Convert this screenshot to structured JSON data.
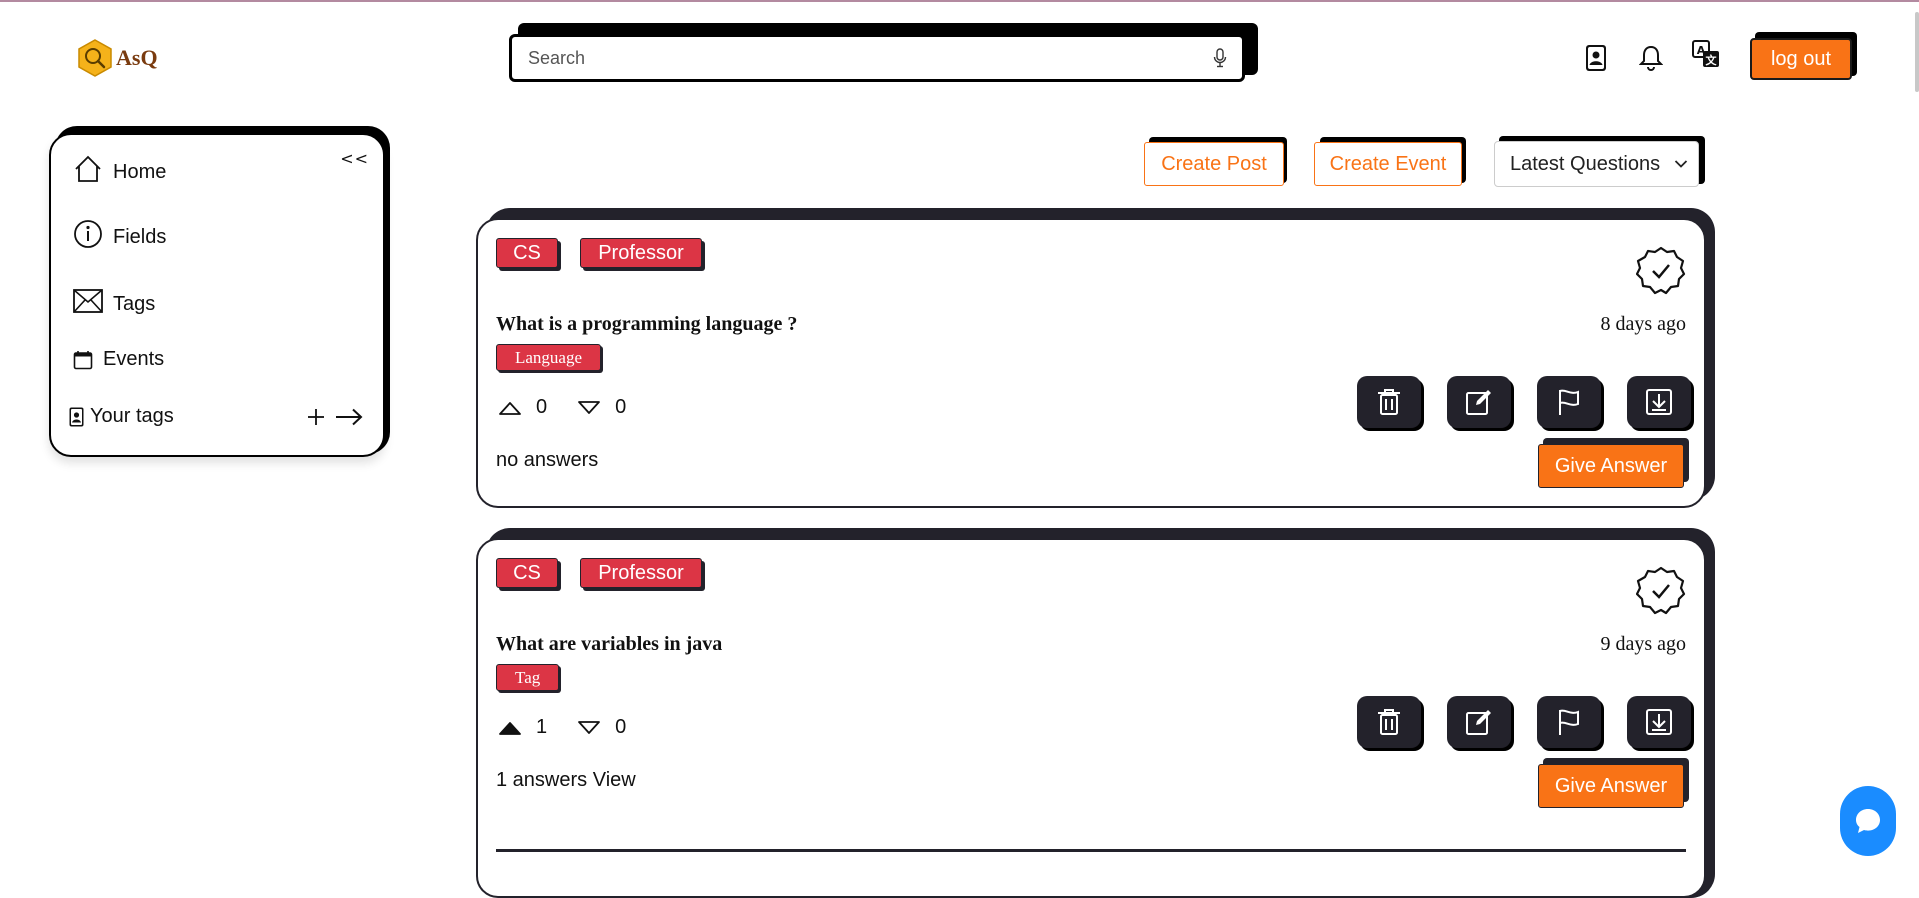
{
  "app": {
    "name": "AsQ"
  },
  "search": {
    "placeholder": "Search"
  },
  "header": {
    "logout_label": "log out"
  },
  "sidebar": {
    "collapse_label": "<<",
    "items": [
      {
        "label": "Home",
        "icon": "home-icon"
      },
      {
        "label": "Fields",
        "icon": "info-icon"
      },
      {
        "label": "Tags",
        "icon": "envelope-icon"
      },
      {
        "label": "Events",
        "icon": "calendar-icon"
      },
      {
        "label": "Your tags",
        "icon": "contact-card-icon"
      }
    ]
  },
  "toolbar": {
    "create_post": "Create Post",
    "create_event": "Create Event",
    "sort_selected": "Latest Questions"
  },
  "posts": [
    {
      "chips": [
        "CS",
        "Professor"
      ],
      "title": "What is a programming language ?",
      "time": "8 days ago",
      "tag": "Language",
      "upvotes": "0",
      "downvotes": "0",
      "upvoted": false,
      "answers": "no answers",
      "give_answer": "Give Answer"
    },
    {
      "chips": [
        "CS",
        "Professor"
      ],
      "title": "What are variables in java",
      "time": "9 days ago",
      "tag": "Tag",
      "upvotes": "1",
      "downvotes": "0",
      "upvoted": true,
      "answers": "1 answers View",
      "give_answer": "Give Answer"
    }
  ],
  "colors": {
    "accent": "#f97316",
    "chip": "#dc3545",
    "card_border": "#23222b",
    "chat": "#1a8cff"
  }
}
